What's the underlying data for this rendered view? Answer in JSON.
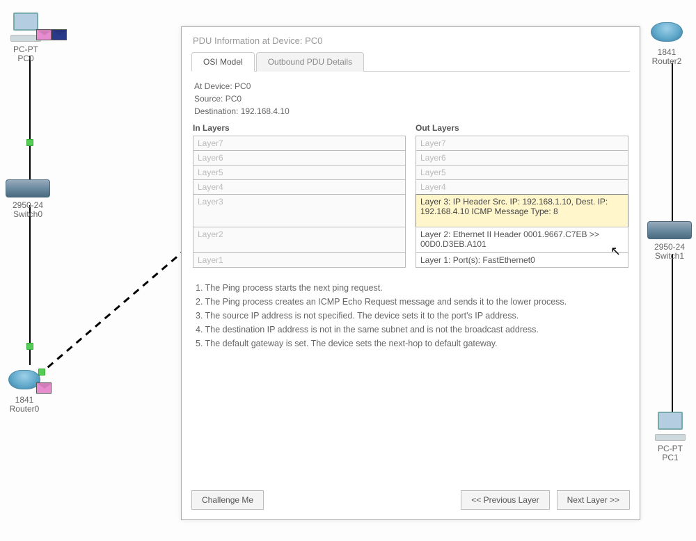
{
  "topology": {
    "pc0": {
      "line1": "PC-PT",
      "line2": "PC0"
    },
    "switch0": {
      "line1": "2950-24",
      "line2": "Switch0"
    },
    "router0": {
      "line1": "1841",
      "line2": "Router0"
    },
    "router2": {
      "line1": "1841",
      "line2": "Router2"
    },
    "switch1": {
      "line1": "2950-24",
      "line2": "Switch1"
    },
    "pc1": {
      "line1": "PC-PT",
      "line2": "PC1"
    }
  },
  "pdu": {
    "title": "PDU Information at Device: PC0",
    "tabs": {
      "osi": "OSI Model",
      "outbound": "Outbound PDU Details"
    },
    "meta": {
      "at_device_label": "At Device: PC0",
      "source_label": "Source: PC0",
      "dest_label": "Destination: 192.168.4.10"
    },
    "in": {
      "head": "In Layers",
      "l7": "Layer7",
      "l6": "Layer6",
      "l5": "Layer5",
      "l4": "Layer4",
      "l3": "Layer3",
      "l2": "Layer2",
      "l1": "Layer1"
    },
    "out": {
      "head": "Out Layers",
      "l7": "Layer7",
      "l6": "Layer6",
      "l5": "Layer5",
      "l4": "Layer4",
      "l3": "Layer 3: IP Header Src. IP: 192.168.1.10, Dest. IP: 192.168.4.10 ICMP Message Type: 8",
      "l2": "Layer 2: Ethernet II Header 0001.9667.C7EB >> 00D0.D3EB.A101",
      "l1": "Layer 1: Port(s): FastEthernet0"
    },
    "desc": "1. The Ping process starts the next ping request.\n2. The Ping process creates an ICMP Echo Request message and sends it to the lower process.\n3. The source IP address is not specified. The device sets it to the port's IP address.\n4. The destination IP address is not in the same subnet and is not the broadcast address.\n5. The default gateway is set. The device sets the next-hop to default gateway.",
    "buttons": {
      "challenge": "Challenge Me",
      "prev": "<< Previous Layer",
      "next": "Next Layer >>"
    }
  }
}
